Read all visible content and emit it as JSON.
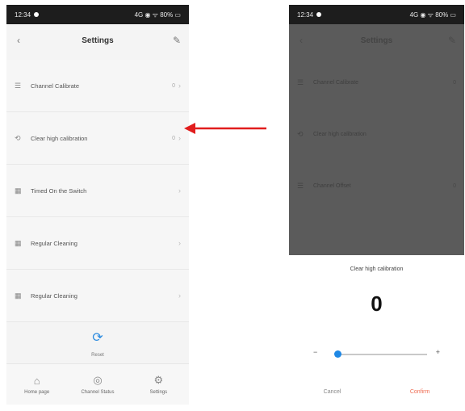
{
  "left_phone": {
    "status": {
      "time": "12:34",
      "icons": "4G ◉ ᯤ 80% ▭"
    },
    "header": {
      "title": "Settings",
      "back_icon": "chevron-left-icon",
      "edit_icon": "edit-icon"
    },
    "items": [
      {
        "label": "Channel Calibrate",
        "value": "0",
        "icon": "sliders-icon"
      },
      {
        "label": "Clear high calibration",
        "value": "0",
        "icon": "calibrate-icon"
      },
      {
        "label": "Timed On the Switch",
        "value": "",
        "icon": "calendar-icon"
      },
      {
        "label": "Regular Cleaning",
        "value": "",
        "icon": "calendar-icon"
      },
      {
        "label": "Regular Cleaning",
        "value": "",
        "icon": "calendar-icon"
      }
    ],
    "reset": {
      "label": "Reset",
      "icon": "reset-icon"
    },
    "nav": [
      {
        "label": "Home page",
        "icon": "home-icon"
      },
      {
        "label": "Channel Status",
        "icon": "status-icon"
      },
      {
        "label": "Settings",
        "icon": "settings-icon"
      }
    ]
  },
  "right_phone": {
    "status": {
      "time": "12:34",
      "icons": "4G ◉ ᯤ 80% ▭"
    },
    "header": {
      "title": "Settings"
    },
    "items": [
      {
        "label": "Channel Calibrate",
        "value": "0"
      },
      {
        "label": "Clear high calibration",
        "value": ""
      },
      {
        "label": "Channel Offset",
        "value": "0"
      }
    ],
    "sheet": {
      "title": "Clear high calibration",
      "value": "0",
      "minus": "−",
      "plus": "+",
      "slider_level": 0,
      "cancel": "Cancel",
      "confirm": "Confirm"
    }
  },
  "colors": {
    "arrow": "#e11d1d",
    "accent": "#1e88e5",
    "confirm": "#ef6c52"
  }
}
